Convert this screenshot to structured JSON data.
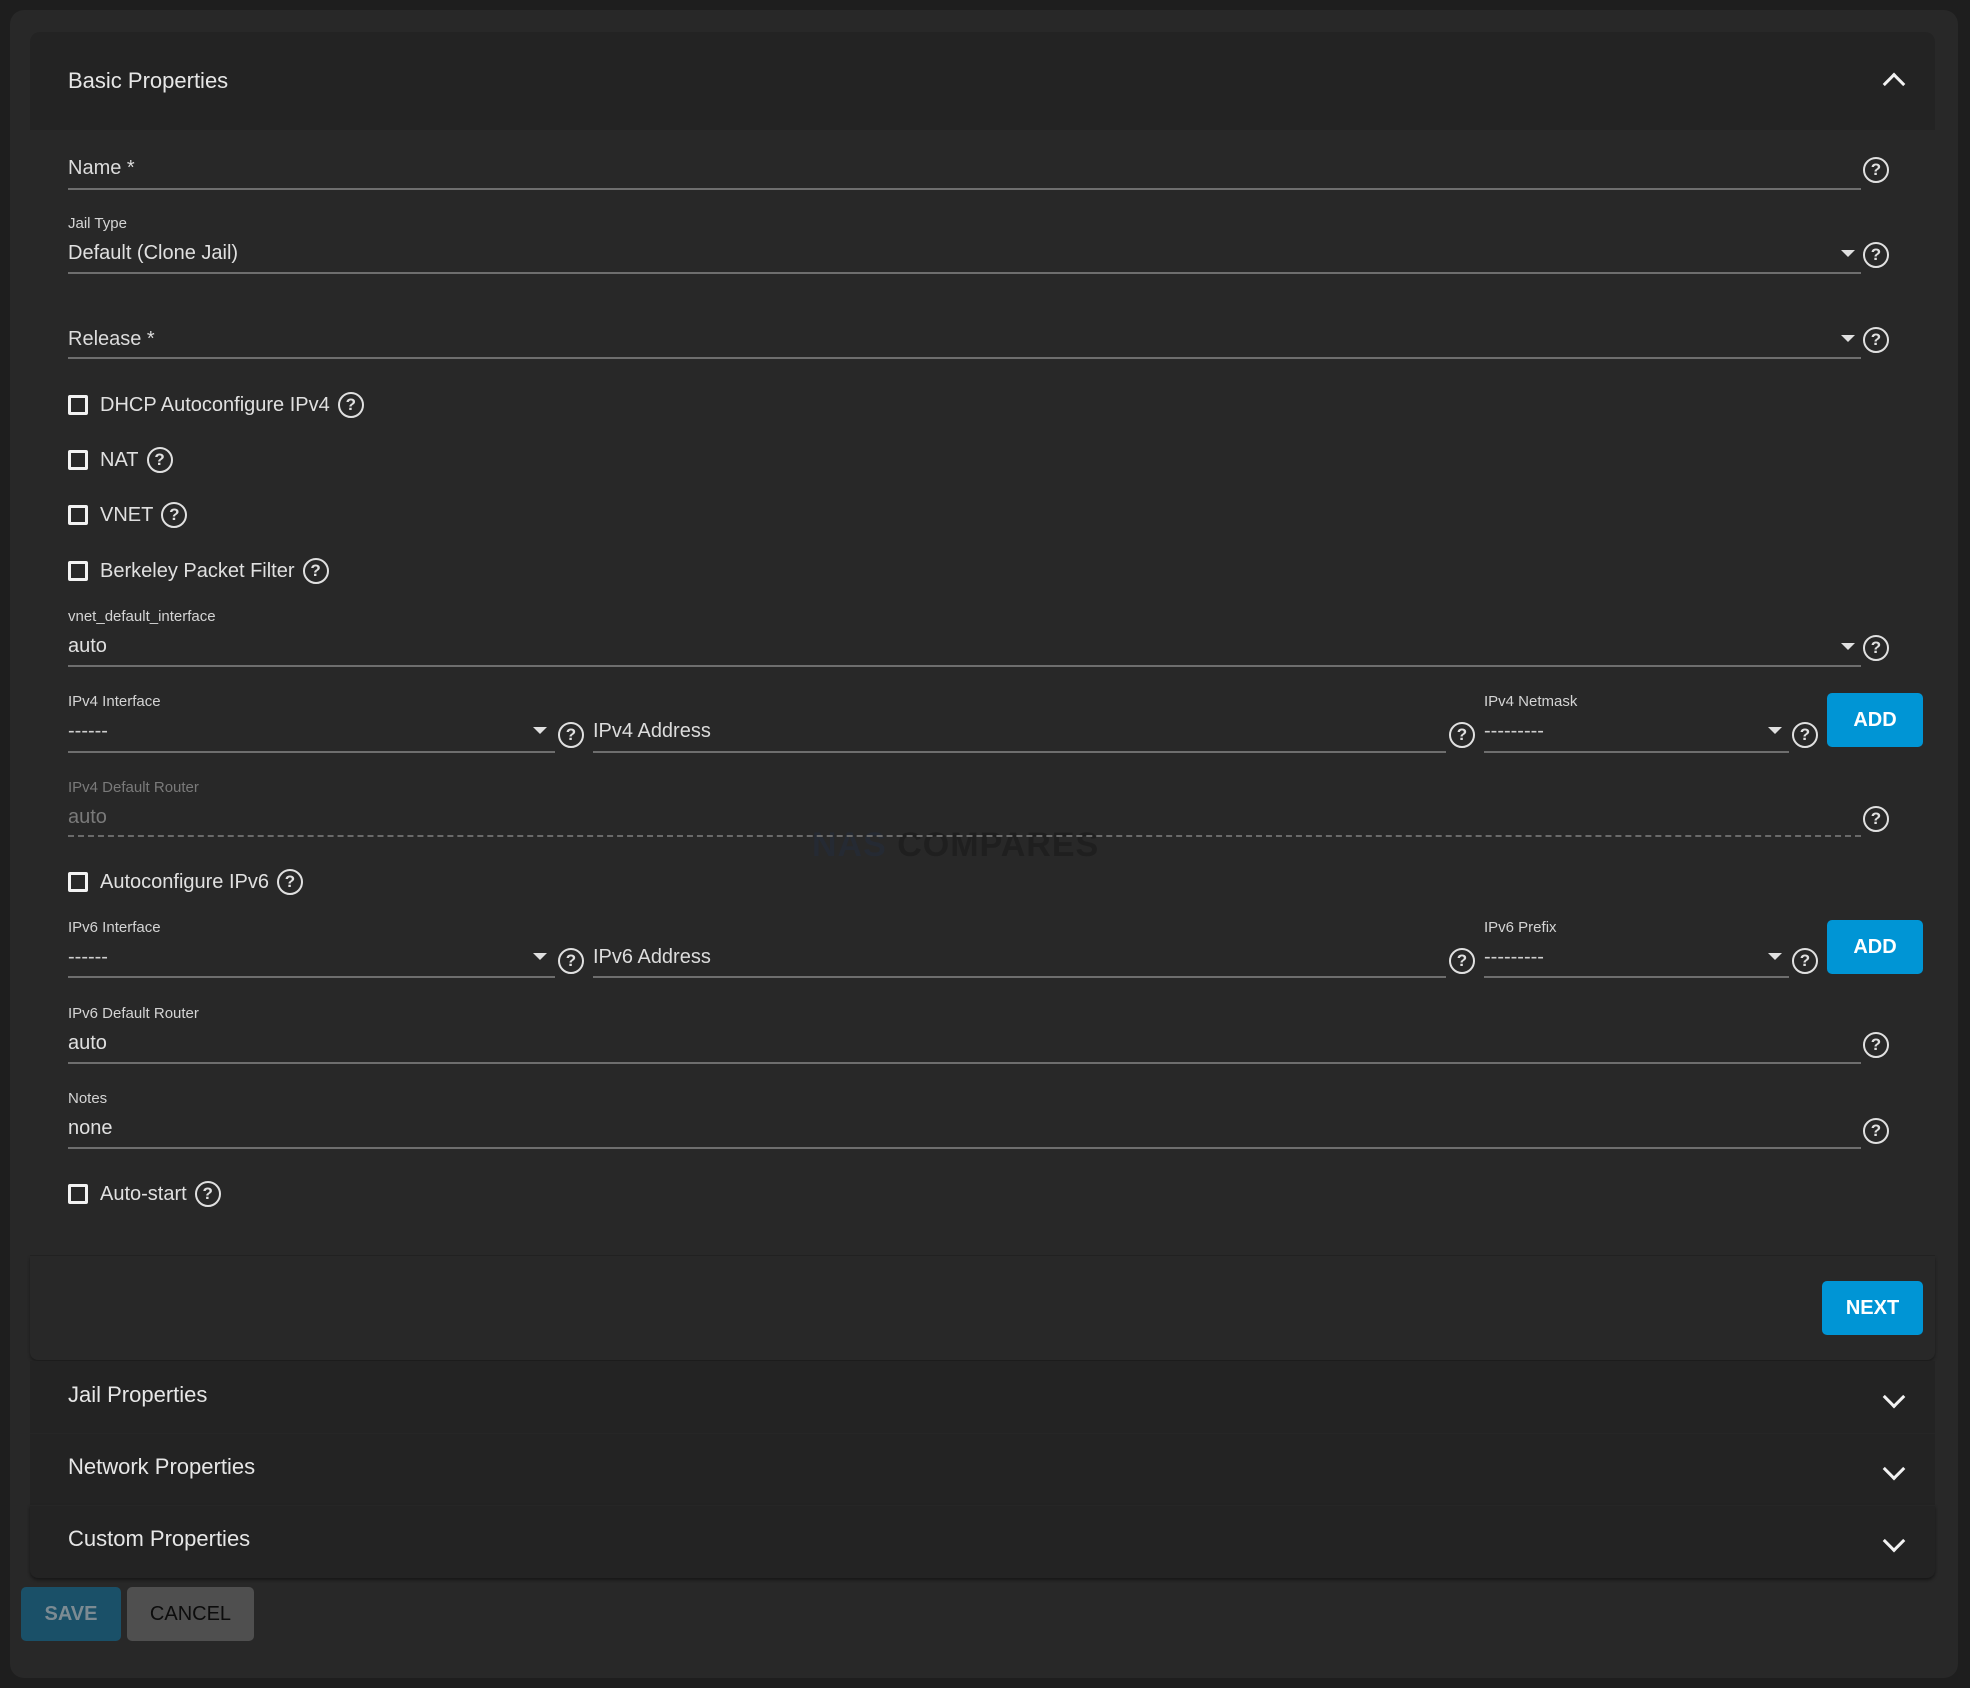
{
  "sections": {
    "basic": {
      "title": "Basic Properties",
      "expanded": true
    },
    "jail": {
      "title": "Jail Properties"
    },
    "network": {
      "title": "Network Properties"
    },
    "custom": {
      "title": "Custom Properties"
    }
  },
  "fields": {
    "name": {
      "placeholder": "Name *",
      "value": ""
    },
    "jail_type": {
      "label": "Jail Type",
      "value": "Default (Clone Jail)"
    },
    "release": {
      "placeholder": "Release *",
      "value": ""
    },
    "vnet_default_interface": {
      "label": "vnet_default_interface",
      "value": "auto"
    },
    "ipv4_interface": {
      "label": "IPv4 Interface",
      "value": "------"
    },
    "ipv4_address": {
      "placeholder": "IPv4 Address",
      "value": ""
    },
    "ipv4_netmask": {
      "label": "IPv4 Netmask",
      "value": "---------"
    },
    "ipv4_default_router": {
      "label": "IPv4 Default Router",
      "value": "auto",
      "disabled": true
    },
    "ipv6_interface": {
      "label": "IPv6 Interface",
      "value": "------"
    },
    "ipv6_address": {
      "placeholder": "IPv6 Address",
      "value": ""
    },
    "ipv6_prefix": {
      "label": "IPv6 Prefix",
      "value": "---------"
    },
    "ipv6_default_router": {
      "label": "IPv6 Default Router",
      "value": "auto"
    },
    "notes": {
      "label": "Notes",
      "value": "none"
    }
  },
  "checkboxes": {
    "dhcp": {
      "label": "DHCP Autoconfigure IPv4",
      "checked": false
    },
    "nat": {
      "label": "NAT",
      "checked": false
    },
    "vnet": {
      "label": "VNET",
      "checked": false
    },
    "bpf": {
      "label": "Berkeley Packet Filter",
      "checked": false
    },
    "autoconf_ipv6": {
      "label": "Autoconfigure IPv6",
      "checked": false
    },
    "autostart": {
      "label": "Auto-start",
      "checked": false
    }
  },
  "buttons": {
    "add_ipv4": "ADD",
    "add_ipv6": "ADD",
    "next": "NEXT",
    "save": "SAVE",
    "cancel": "CANCEL"
  },
  "icons": {
    "help": "?",
    "collapse": "chevron-up-icon",
    "expand": "chevron-down-icon",
    "dropdown": "caret-down-icon"
  },
  "watermark": {
    "part1": "NAS",
    "part2": "COMPARES"
  },
  "colors": {
    "accent": "#0095d5",
    "save_disabled": "#1a5068",
    "cancel_bg": "#4f4f4f",
    "background": "#282828"
  }
}
